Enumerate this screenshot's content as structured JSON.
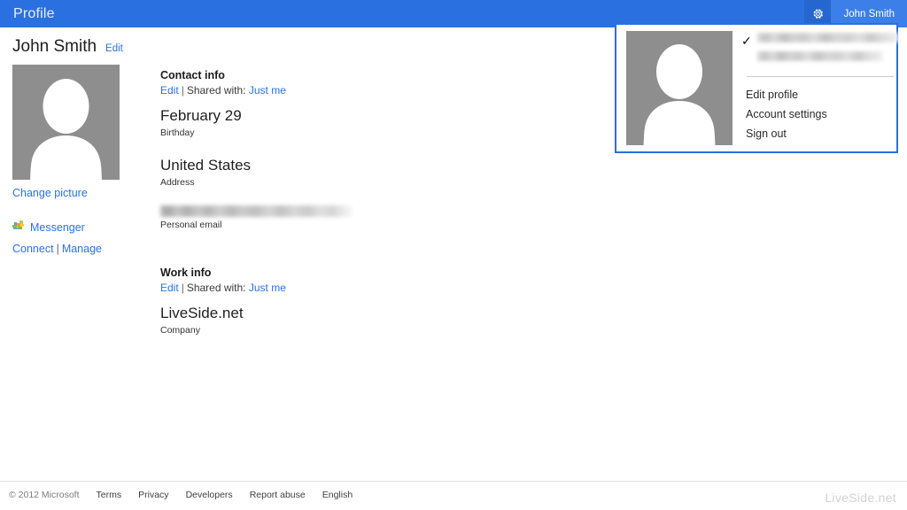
{
  "header": {
    "title": "Profile",
    "gear_icon": "gear-icon",
    "user_name": "John Smith",
    "bg_color": "#2b70e0",
    "gear_bg_color": "#2566cf",
    "user_bg_color": "#3c7fe8"
  },
  "account_flyout": {
    "avatar_icon": "person-avatar-placeholder",
    "checked_icon": "check-mark-icon",
    "account_primary_redacted": "",
    "account_secondary_redacted": "",
    "menu": [
      {
        "label": "Edit profile"
      },
      {
        "label": "Account settings"
      },
      {
        "label": "Sign out"
      }
    ],
    "border_color": "#2b70e0"
  },
  "profile": {
    "name": "John Smith",
    "edit_label": "Edit",
    "avatar_icon": "person-avatar-placeholder",
    "change_picture_label": "Change picture",
    "messenger": {
      "icon": "messenger-icon",
      "label": "Messenger",
      "connect_label": "Connect",
      "separator": "|",
      "manage_label": "Manage"
    }
  },
  "sections": [
    {
      "title": "Contact info",
      "edit_label": "Edit",
      "separator": "|",
      "shared_prefix": "Shared with:",
      "shared_value": "Just me",
      "fields": [
        {
          "value": "February 29",
          "label": "Birthday",
          "redacted": false
        },
        {
          "value": "United States",
          "label": "Address",
          "redacted": false
        },
        {
          "value": "",
          "label": "Personal email",
          "redacted": true
        }
      ]
    },
    {
      "title": "Work info",
      "edit_label": "Edit",
      "separator": "|",
      "shared_prefix": "Shared with:",
      "shared_value": "Just me",
      "fields": [
        {
          "value": "LiveSide.net",
          "label": "Company",
          "redacted": false
        }
      ]
    }
  ],
  "footer": {
    "copyright": "© 2012 Microsoft",
    "links": [
      {
        "label": "Terms"
      },
      {
        "label": "Privacy"
      },
      {
        "label": "Developers"
      },
      {
        "label": "Report abuse"
      },
      {
        "label": "English"
      }
    ]
  },
  "watermark": {
    "text": "LiveSide.net"
  },
  "colors": {
    "accent_blue": "#2b70e0",
    "link_blue": "#2672ec",
    "avatar_gray": "#8e8e8e"
  }
}
